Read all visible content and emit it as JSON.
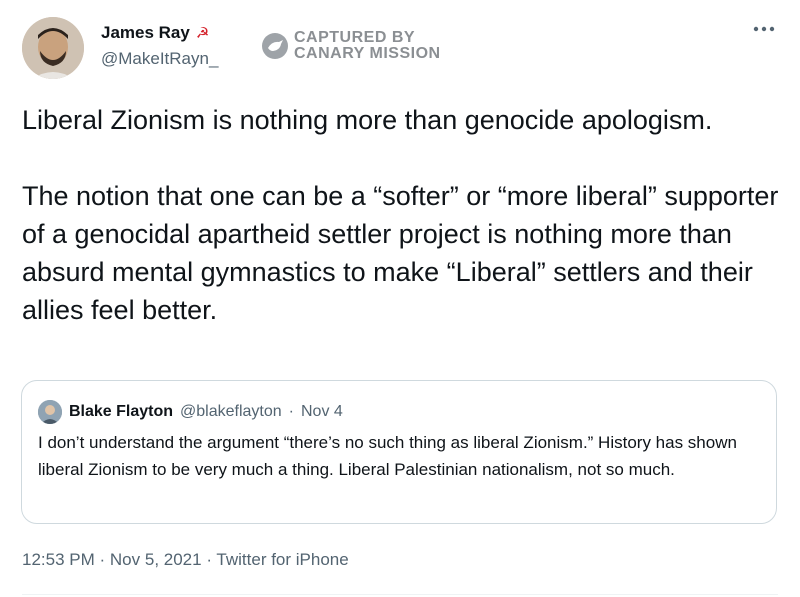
{
  "tweet": {
    "author": {
      "display_name": "James Ray",
      "name_emoji": "☭",
      "handle": "@MakeItRayn_",
      "avatar_icon": "user-avatar"
    },
    "watermark": {
      "line1": "CAPTURED BY",
      "line2": "CANARY MISSION",
      "icon": "canary-bird-icon"
    },
    "more_icon": "more-horizontal-icon",
    "body": {
      "paragraph1": "Liberal Zionism is nothing more than genocide apologism.",
      "paragraph2": "The notion that one can be a “softer” or “more liberal” supporter of a genocidal apartheid settler project is nothing more than absurd mental gymnastics to make “Liberal” settlers and their allies feel better."
    },
    "quoted": {
      "display_name": "Blake Flayton",
      "handle": "@blakeflayton",
      "separator": "·",
      "date": "Nov 4",
      "text": "I don’t understand the argument “there’s no such thing as liberal Zionism.” History has shown liberal Zionism to be very much a thing. Liberal Palestinian nationalism, not so much."
    },
    "meta": {
      "time": "12:53 PM",
      "separator": "·",
      "date": "Nov 5, 2021",
      "source": "Twitter for iPhone"
    }
  },
  "colors": {
    "text_primary": "#0f1419",
    "text_secondary": "#536471",
    "border": "#cfd9de",
    "watermark": "#8b8f93"
  }
}
